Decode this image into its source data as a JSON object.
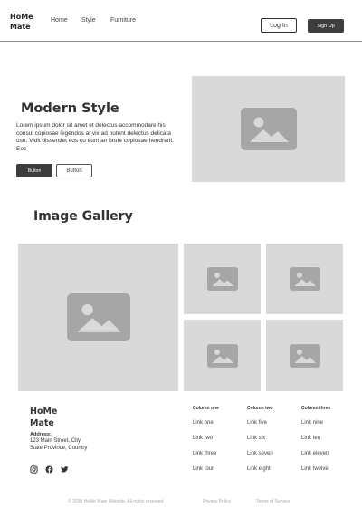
{
  "nav": {
    "logo_line1": "HoMe",
    "logo_line2": "Mate",
    "links": [
      "Home",
      "Style",
      "Furniture"
    ],
    "login_label": "Log In",
    "signup_label": "Sign Up"
  },
  "hero": {
    "title": "Modern Style",
    "text": "Lorem ipsum dolor sit amet et delectus accommodare his consul copiosae legendos at vix ad putent delectus delicata usu. Vidit dissentiet eos cu eum an brute copiosae hendrerit. Eos",
    "primary_label": "Button",
    "secondary_label": "Button",
    "image_icon": "image-placeholder-icon"
  },
  "gallery": {
    "title": "Image Gallery",
    "image_icon": "image-placeholder-icon"
  },
  "footer": {
    "logo_line1": "HoMe",
    "logo_line2": "Mate",
    "address_label": "Address:",
    "address_line1": "123 Main Street, City",
    "address_line2": "State Province, Country",
    "social_icons": [
      "instagram-icon",
      "facebook-icon",
      "twitter-icon"
    ],
    "columns": [
      {
        "title": "Column one",
        "links": [
          "Link one",
          "Link two",
          "Link three",
          "Link four"
        ]
      },
      {
        "title": "Column two",
        "links": [
          "Link five",
          "Link six",
          "Link seven",
          "Link eight"
        ]
      },
      {
        "title": "Column three",
        "links": [
          "Link nine",
          "Link ten",
          "Link eleven",
          "Link twelve"
        ]
      }
    ],
    "copyright": "© 2025 HoMe Mate Website. All rights reserved.",
    "privacy_label": "Privacy Policy",
    "terms_label": "Terms of Service"
  },
  "colors": {
    "placeholder_bg": "#d9d9d9",
    "placeholder_icon": "#a6a6a6",
    "dark_button": "#3d3d3d"
  }
}
